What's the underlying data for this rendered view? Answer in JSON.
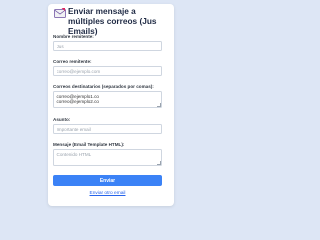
{
  "page": {
    "title": "Enviar mensaje a múltiples correos (Jus Emails)",
    "icon": "envelope-icon"
  },
  "form": {
    "sender_name": {
      "label": "Nombre remitente:",
      "placeholder": "Jus",
      "value": ""
    },
    "sender_email": {
      "label": "Correo remitente:",
      "placeholder": "correo@ejemplo.com",
      "value": ""
    },
    "recipients": {
      "label": "Correos destinatarios (separados por comas):",
      "placeholder": "",
      "value": "correo@ejemplo1.co\ncorreo@ejemplo2.co"
    },
    "subject": {
      "label": "Asunto:",
      "placeholder": "Importante email",
      "value": ""
    },
    "message": {
      "label": "Mensaje (Email Template HTML):",
      "placeholder": "Contenido HTML",
      "value": ""
    }
  },
  "actions": {
    "send_label": "Enviar",
    "send_again_label": "Enviar otro email"
  },
  "colors": {
    "background": "#dde6f5",
    "accent": "#3b82f6",
    "link": "#2563eb"
  }
}
